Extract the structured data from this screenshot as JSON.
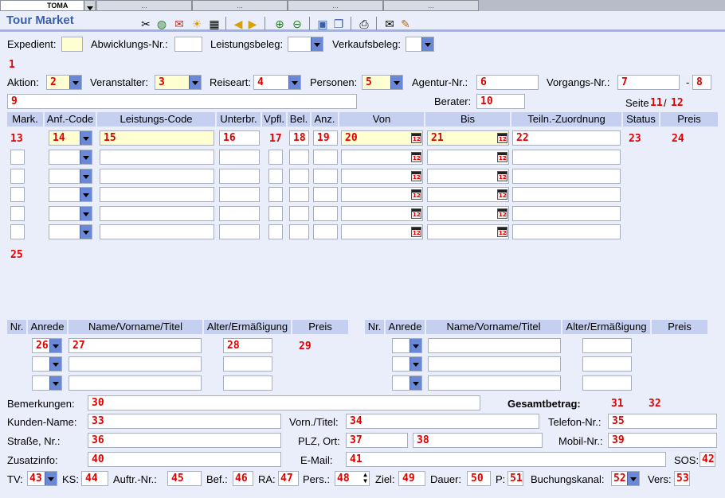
{
  "tabs": [
    {
      "label": "TOMA"
    },
    {
      "label": "..."
    },
    {
      "label": "..."
    },
    {
      "label": "..."
    },
    {
      "label": "..."
    }
  ],
  "title": "Tour Market",
  "toolbar": {
    "icons": [
      "tools-icon",
      "search-web-icon",
      "mail-open-icon",
      "sun-icon",
      "calculator-icon",
      "prev-icon",
      "next-icon",
      "zoom-in-icon",
      "zoom-out-icon",
      "disk-icon",
      "copy-icon",
      "print-icon",
      "envelope-icon",
      "broom-icon"
    ]
  },
  "header": {
    "expedient_label": "Expedient:",
    "abwicklung_label": "Abwicklungs-Nr.:",
    "leistungsbeleg_label": "Leistungsbeleg:",
    "verkaufsbeleg_label": "Verkaufsbeleg:",
    "marker_1": "1",
    "aktion_label": "Aktion:",
    "aktion_value": "2",
    "veranstalter_label": "Veranstalter:",
    "veranstalter_value": "3",
    "reiseart_label": "Reiseart:",
    "reiseart_value": "4",
    "personen_label": "Personen:",
    "personen_value": "5",
    "agentur_label": "Agentur-Nr.:",
    "agentur_value": "6",
    "vorgang_label": "Vorgangs-Nr.:",
    "vorgang_value": "7",
    "vorgang_dash": "-",
    "vorgang_suffix": "8",
    "field9": "9",
    "berater_label": "Berater:",
    "berater_value": "10",
    "seite_label": "Seite",
    "seite_value": "11",
    "seite_slash": "/",
    "seite_total": "12"
  },
  "services": {
    "columns": [
      "Mark.",
      "Anf.-Code",
      "Leistungs-Code",
      "Unterbr.",
      "Vpfl.",
      "Bel.",
      "Anz.",
      "Von",
      "Bis",
      "Teiln.-Zuordnung",
      "Status",
      "Preis"
    ],
    "row1": {
      "mark": "13",
      "anf": "14",
      "code": "15",
      "unterbr": "16",
      "vpfl": "17",
      "bel": "18",
      "anz": "19",
      "von": "20",
      "bis": "21",
      "teiln": "22",
      "status": "23",
      "preis": "24"
    },
    "footer_marker": "25"
  },
  "persons": {
    "columns": [
      "Nr.",
      "Anrede",
      "Name/Vorname/Titel",
      "Alter/Ermäßigung",
      "Preis"
    ],
    "row1": {
      "anrede": "26",
      "name": "27",
      "alter": "28",
      "preis": "29"
    }
  },
  "footer": {
    "bemerkungen_label": "Bemerkungen:",
    "bemerkungen_value": "30",
    "gesamt_label": "Gesamtbetrag:",
    "gesamt_value": "31",
    "gesamt_value2": "32",
    "kunde_label": "Kunden-Name:",
    "kunde_value": "33",
    "vorn_label": "Vorn./Titel:",
    "vorn_value": "34",
    "telefon_label": "Telefon-Nr.:",
    "telefon_value": "35",
    "strasse_label": "Straße, Nr.:",
    "strasse_value": "36",
    "plz_label": "PLZ, Ort:",
    "plz_value": "37",
    "ort_value": "38",
    "mobil_label": "Mobil-Nr.:",
    "mobil_value": "39",
    "zusatz_label": "Zusatzinfo:",
    "zusatz_value": "40",
    "email_label": "E-Mail:",
    "email_value": "41",
    "sos_label": "SOS:",
    "sos_value": "42",
    "tv_label": "TV:",
    "tv_value": "43",
    "ks_label": "KS:",
    "ks_value": "44",
    "auftr_label": "Auftr.-Nr.:",
    "auftr_value": "45",
    "bef_label": "Bef.:",
    "bef_value": "46",
    "ra_label": "RA:",
    "ra_value": "47",
    "pers_label": "Pers.:",
    "pers_value": "48",
    "ziel_label": "Ziel:",
    "ziel_value": "49",
    "dauer_label": "Dauer:",
    "dauer_value": "50",
    "p_label": "P:",
    "p_value": "51",
    "kanal_label": "Buchungskanal:",
    "kanal_value": "52",
    "vers_label": "Vers:",
    "vers_value": "53"
  }
}
